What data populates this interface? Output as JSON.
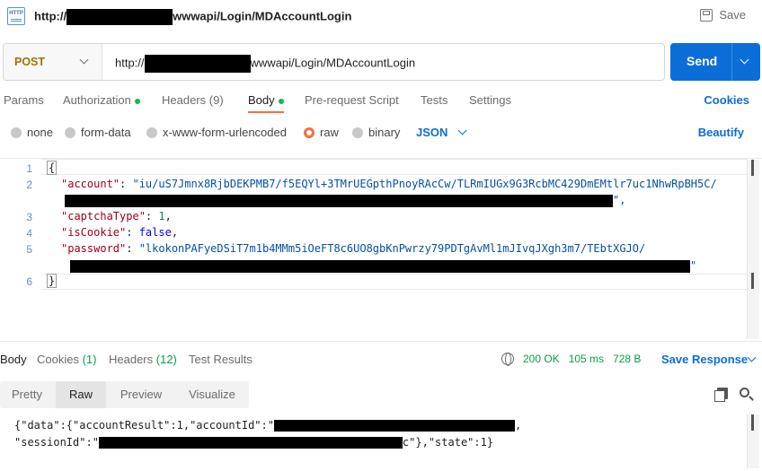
{
  "title": {
    "prefix": "http://",
    "suffix": "wwwapi/Login/MDAccountLogin",
    "save_label": "Save"
  },
  "request": {
    "method": "POST",
    "url_prefix": "http://",
    "url_suffix": "wwwapi/Login/MDAccountLogin",
    "send_label": "Send"
  },
  "tabs": {
    "params": "Params",
    "authorization": "Authorization",
    "headers": "Headers",
    "headers_count": "(9)",
    "body": "Body",
    "prerequest": "Pre-request Script",
    "tests": "Tests",
    "settings": "Settings",
    "cookies": "Cookies"
  },
  "body_types": {
    "none": "none",
    "form_data": "form-data",
    "urlencoded": "x-www-form-urlencoded",
    "raw": "raw",
    "binary": "binary",
    "format": "JSON",
    "beautify": "Beautify"
  },
  "editor": {
    "line_numbers": [
      "1",
      "2",
      "3",
      "4",
      "5",
      "6"
    ],
    "open_brace": "{",
    "close_brace": "}",
    "account_key": "\"account\"",
    "account_value": "\"iu/uS7Jmnx8RjbDEKPMB7/f5EQYl+3TMrUEGpthPnoyRAcCw/TLRmIUGx9G3RcbMC429DmEMtlr7uc1NhwRpBH5C/",
    "account_tail": "\",",
    "captcha_key": "\"captchaType\"",
    "captcha_value": "1",
    "iscookie_key": "\"isCookie\"",
    "iscookie_value": "false",
    "password_key": "\"password\"",
    "password_value": "\"lkokonPAFyeDSiT7m1b4MMm5iOeFT8c6UO8gbKnPwrzy79PDTgAvMl1mJIvqJXgh3m7/TEbtXGJO/",
    "password_tail": "\""
  },
  "response": {
    "tabs": {
      "body": "Body",
      "cookies": "Cookies",
      "cookies_count": "(1)",
      "headers": "Headers",
      "headers_count": "(12)",
      "test_results": "Test Results"
    },
    "status": "200 OK",
    "time": "105 ms",
    "size": "728 B",
    "save_response": "Save Response",
    "views": [
      "Pretty",
      "Raw",
      "Preview",
      "Visualize"
    ],
    "line1_start": "{\"data\":{\"accountResult\":1,\"accountId\":\"",
    "line1_end": ",",
    "line2_start": "\"sessionId\":\"",
    "line2_end": "c\"},\"state\":1}"
  },
  "colors": {
    "accent": "#ff6c37",
    "primary": "#0b6ed8",
    "success": "#0a9c4a"
  }
}
